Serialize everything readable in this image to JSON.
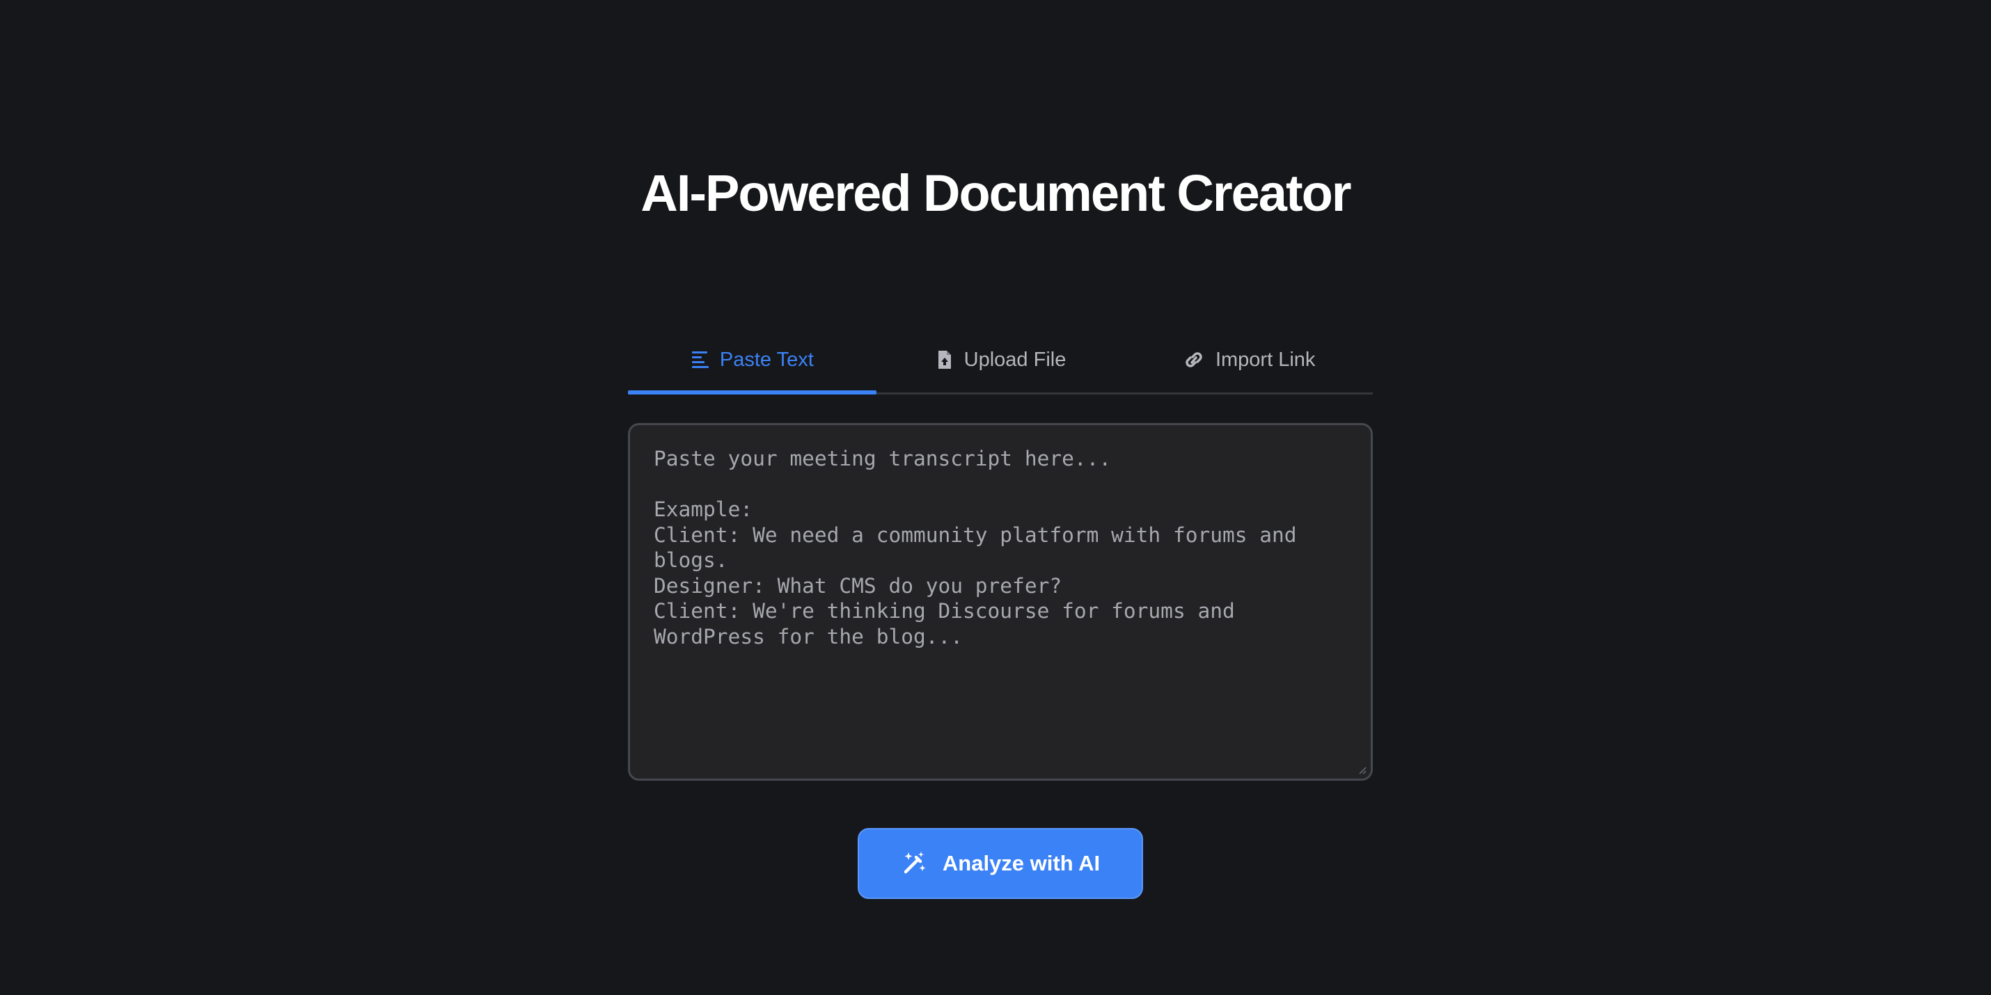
{
  "header": {
    "title": "AI-Powered Document Creator"
  },
  "tabs": [
    {
      "label": "Paste Text",
      "icon": "align-left-icon",
      "active": true
    },
    {
      "label": "Upload File",
      "icon": "file-upload-icon",
      "active": false
    },
    {
      "label": "Import Link",
      "icon": "link-icon",
      "active": false
    }
  ],
  "transcript": {
    "value": "",
    "placeholder": "Paste your meeting transcript here...\n\nExample:\nClient: We need a community platform with forums and blogs.\nDesigner: What CMS do you prefer?\nClient: We're thinking Discourse for forums and WordPress for the blog..."
  },
  "actions": {
    "analyze_label": "Analyze with AI",
    "analyze_icon": "magic-wand-icon"
  },
  "colors": {
    "background": "#16171a",
    "accent": "#3b82f6",
    "tab_inactive": "#b4b7bd",
    "input_background": "#232326"
  }
}
